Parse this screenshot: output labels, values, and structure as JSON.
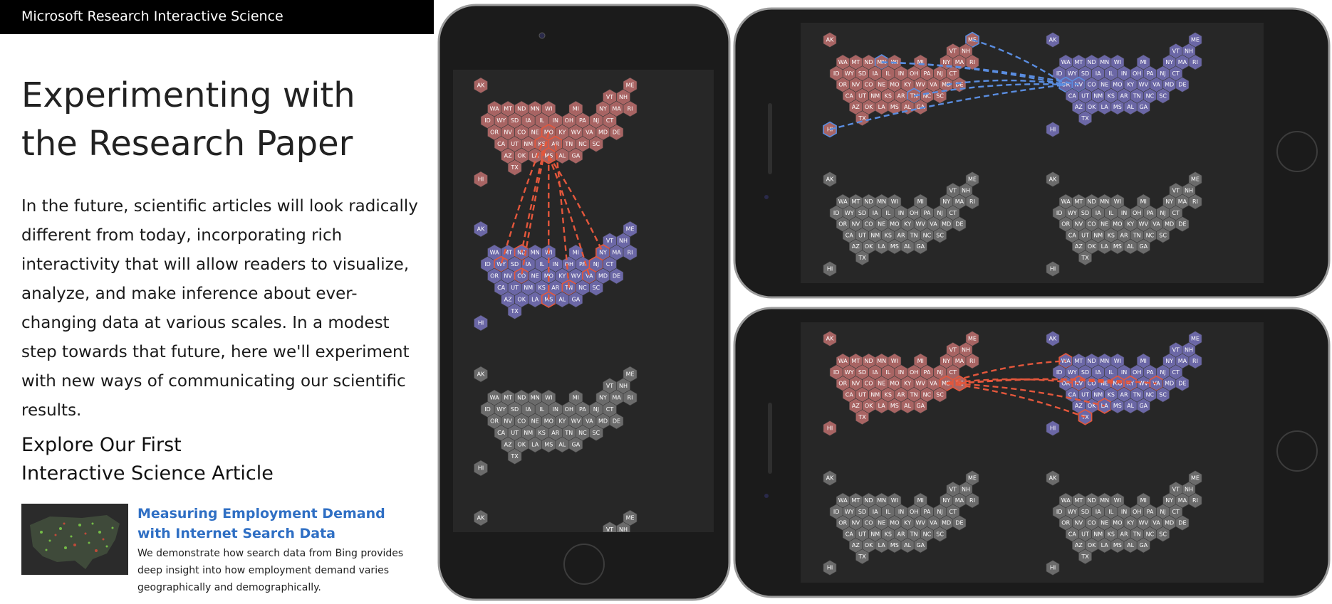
{
  "header": {
    "site_title": "Microsoft Research Interactive Science"
  },
  "hero": {
    "title": "Experimenting with the Research Paper",
    "intro": "In the future, scientific articles will look radically different from today, incorporating rich interactivity that will allow readers to visualize, analyze, and make inference about ever-changing data at various scales. In a modest step towards that future, here we'll experiment with new ways of communicating our scientific results."
  },
  "explore": {
    "line1": "Explore Our First",
    "line2": "Interactive Science Article"
  },
  "article": {
    "title_line1": "Measuring Employment Demand",
    "title_line2": "with Internet Search Data",
    "description": "We demonstrate how search data from Bing provides deep insight into how employment demand varies geographically and demographically."
  },
  "colors": {
    "red_state": "#a86463",
    "blue_state": "#6b67a6",
    "gray_state": "#6b6b6b",
    "highlight_red": "#e4573c",
    "highlight_blue": "#5a8de0",
    "phone_body": "#1b1b1b",
    "screen": "#272727"
  },
  "hex_map": {
    "state_rows": [
      [
        "AK",
        "",
        "",
        "",
        "",
        "",
        "",
        "",
        "",
        "",
        "",
        "ME"
      ],
      [
        "",
        "",
        "",
        "",
        "",
        "",
        "",
        "",
        "",
        "VT",
        "NH",
        ""
      ],
      [
        "",
        "WA",
        "MT",
        "ND",
        "MN",
        "WI",
        "",
        "MI",
        "",
        "NY",
        "MA",
        "RI"
      ],
      [
        "ID",
        "WY",
        "SD",
        "IA",
        "IL",
        "IN",
        "OH",
        "PA",
        "NJ",
        "CT",
        "",
        ""
      ],
      [
        "OR",
        "NV",
        "CO",
        "NE",
        "MO",
        "KY",
        "WV",
        "VA",
        "MD",
        "DE",
        "",
        ""
      ],
      [
        "CA",
        "UT",
        "NM",
        "KS",
        "AR",
        "TN",
        "NC",
        "SC",
        "",
        "",
        "",
        ""
      ],
      [
        "AZ",
        "OK",
        "LA",
        "MS",
        "AL",
        "GA",
        "",
        "",
        "",
        "",
        "",
        ""
      ],
      [
        "TX",
        "",
        "",
        "",
        "",
        "",
        "",
        "",
        "",
        "",
        "",
        ""
      ],
      [
        "HI",
        "",
        "",
        "",
        "",
        "",
        "",
        "",
        "",
        "",
        "",
        ""
      ]
    ]
  }
}
